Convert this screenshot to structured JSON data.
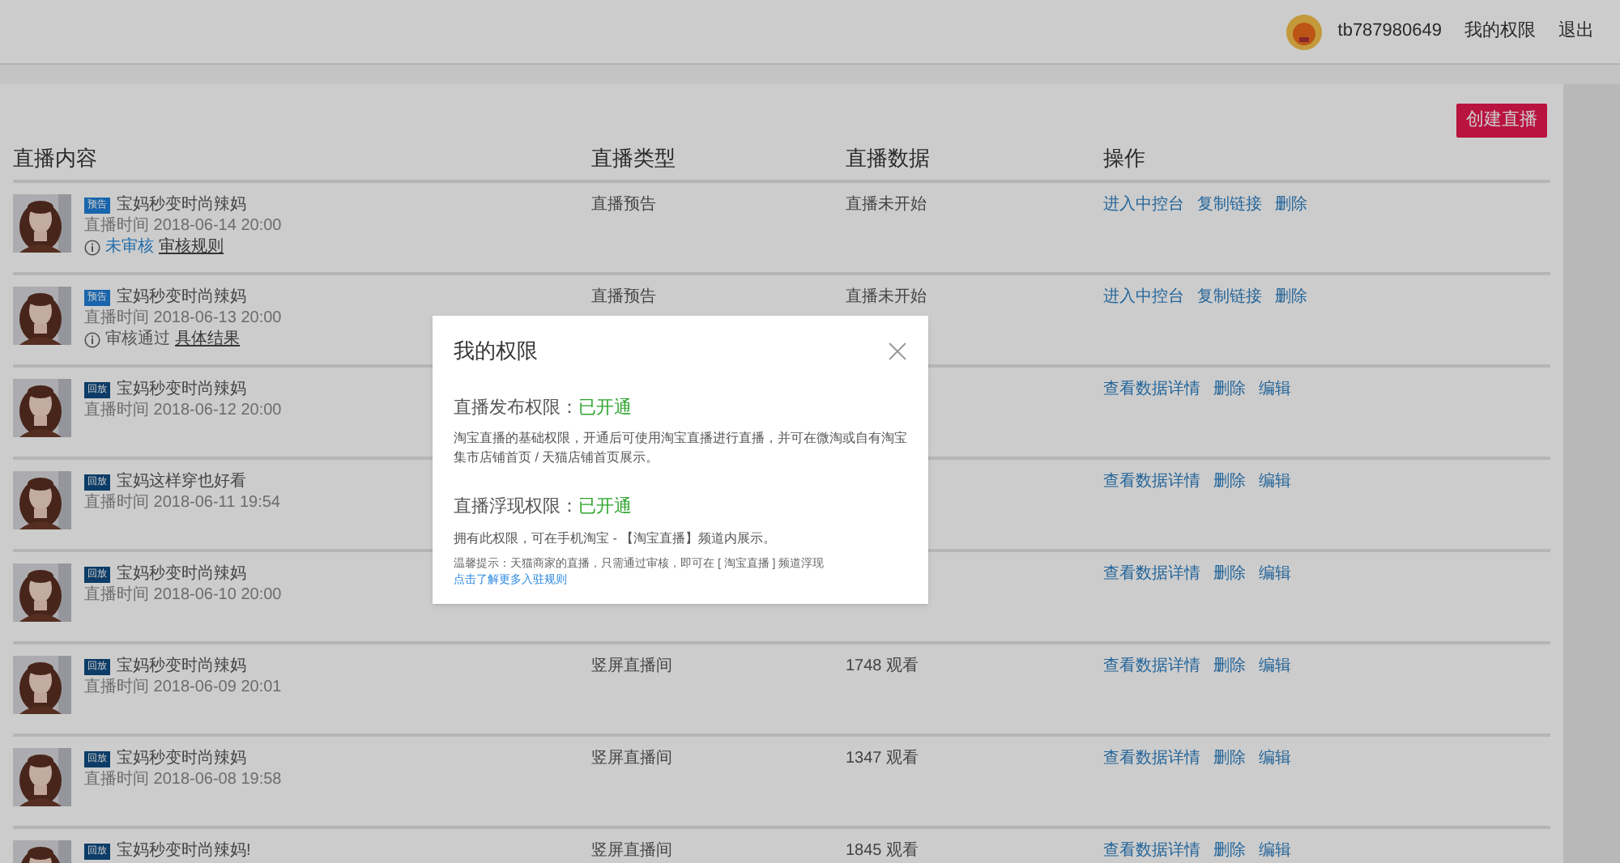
{
  "header": {
    "username": "tb787980649",
    "links": [
      "我的权限",
      "退出"
    ]
  },
  "create_button": "创建直播",
  "table": {
    "columns": [
      "直播内容",
      "直播类型",
      "直播数据",
      "操作"
    ],
    "rows": [
      {
        "badge": {
          "kind": "preview",
          "label": "预告"
        },
        "title": "宝妈秒变时尚辣妈",
        "time": "直播时间 2018-06-14 20:00",
        "review": {
          "pending": true,
          "status": "未审核",
          "link": "审核规则"
        },
        "type": "直播预告",
        "data": "直播未开始",
        "actions": [
          "进入中控台",
          "复制链接",
          "删除"
        ]
      },
      {
        "badge": {
          "kind": "preview",
          "label": "预告"
        },
        "title": "宝妈秒变时尚辣妈",
        "time": "直播时间 2018-06-13 20:00",
        "review": {
          "pending": false,
          "status": "审核通过",
          "link": "具体结果"
        },
        "type": "直播预告",
        "data": "直播未开始",
        "actions": [
          "进入中控台",
          "复制链接",
          "删除"
        ]
      },
      {
        "badge": {
          "kind": "replay",
          "label": "回放"
        },
        "title": "宝妈秒变时尚辣妈",
        "time": "直播时间 2018-06-12 20:00",
        "actions": [
          "查看数据详情",
          "删除",
          "编辑"
        ]
      },
      {
        "badge": {
          "kind": "replay",
          "label": "回放"
        },
        "title": "宝妈这样穿也好看",
        "time": "直播时间 2018-06-11 19:54",
        "actions": [
          "查看数据详情",
          "删除",
          "编辑"
        ]
      },
      {
        "badge": {
          "kind": "replay",
          "label": "回放"
        },
        "title": "宝妈秒变时尚辣妈",
        "time": "直播时间 2018-06-10 20:00",
        "actions": [
          "查看数据详情",
          "删除",
          "编辑"
        ]
      },
      {
        "badge": {
          "kind": "replay",
          "label": "回放"
        },
        "title": "宝妈秒变时尚辣妈",
        "time": "直播时间 2018-06-09 20:01",
        "type": "竖屏直播间",
        "data": "1748 观看",
        "actions": [
          "查看数据详情",
          "删除",
          "编辑"
        ]
      },
      {
        "badge": {
          "kind": "replay",
          "label": "回放"
        },
        "title": "宝妈秒变时尚辣妈",
        "time": "直播时间 2018-06-08 19:58",
        "type": "竖屏直播间",
        "data": "1347 观看",
        "actions": [
          "查看数据详情",
          "删除",
          "编辑"
        ]
      },
      {
        "badge": {
          "kind": "replay",
          "label": "回放"
        },
        "title": "宝妈秒变时尚辣妈!",
        "type": "竖屏直播间",
        "data": "1845 观看",
        "actions": [
          "查看数据详情",
          "删除",
          "编辑"
        ]
      }
    ]
  },
  "modal": {
    "title": "我的权限",
    "sections": [
      {
        "label": "直播发布权限：",
        "status": "已开通",
        "description": "淘宝直播的基础权限，开通后可使用淘宝直播进行直播，并可在微淘或自有淘宝集市店铺首页 / 天猫店铺首页展示。"
      },
      {
        "label": "直播浮现权限：",
        "status": "已开通",
        "description": "拥有此权限，可在手机淘宝 - 【淘宝直播】频道内展示。"
      }
    ],
    "tip": "温馨提示：天猫商家的直播，只需通过审核，即可在 [ 淘宝直播 ] 频道浮现",
    "tip_link": "点击了解更多入驻规则"
  }
}
